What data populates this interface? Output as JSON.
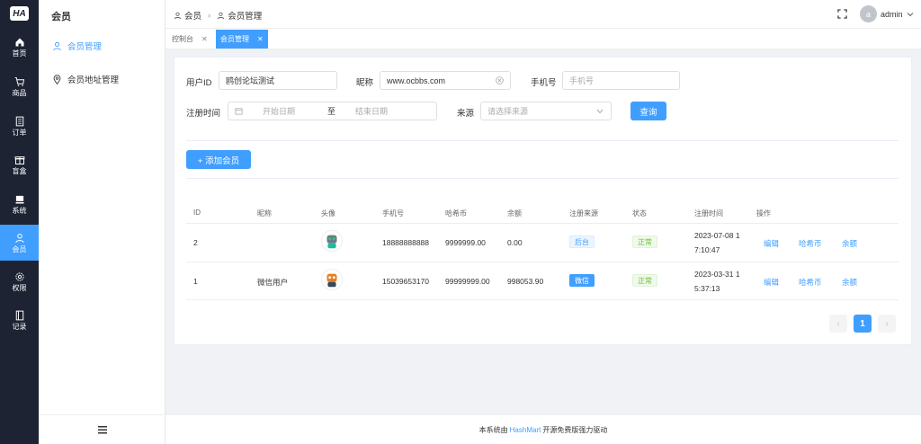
{
  "rail": {
    "logo": "HA",
    "items": [
      {
        "label": "首页"
      },
      {
        "label": "商品"
      },
      {
        "label": "订单"
      },
      {
        "label": "盲盒"
      },
      {
        "label": "系统"
      },
      {
        "label": "会员"
      },
      {
        "label": "权限"
      },
      {
        "label": "记录"
      }
    ]
  },
  "submenu": {
    "title": "会员",
    "items": [
      {
        "label": "会员管理"
      },
      {
        "label": "会员地址管理"
      }
    ]
  },
  "header": {
    "breadcrumb": [
      "会员",
      "会员管理"
    ],
    "avatar_letter": "a",
    "username": "admin"
  },
  "tabs": [
    {
      "label": "控制台"
    },
    {
      "label": "会员管理"
    }
  ],
  "filters": {
    "user_id_label": "用户ID",
    "user_id_value": "鸥创论坛测试",
    "nickname_label": "昵称",
    "nickname_value": "www.ocbbs.com",
    "phone_label": "手机号",
    "phone_placeholder": "手机号",
    "reg_time_label": "注册时间",
    "start_placeholder": "开始日期",
    "range_sep": "至",
    "end_placeholder": "结束日期",
    "source_label": "来源",
    "source_placeholder": "请选择来源",
    "query_button": "查询"
  },
  "add_button": "+ 添加会员",
  "table": {
    "headers": [
      "ID",
      "昵称",
      "头像",
      "手机号",
      "哈希币",
      "余额",
      "注册来源",
      "状态",
      "注册时间",
      "操作"
    ],
    "rows": [
      {
        "id": "2",
        "nickname": "",
        "phone": "18888888888",
        "hash": "9999999.00",
        "balance": "0.00",
        "source": "后台",
        "status": "正常",
        "time1": "2023-07-08 1",
        "time2": "7:10:47",
        "a1": "编辑",
        "a2": "哈希币",
        "a3": "余额"
      },
      {
        "id": "1",
        "nickname": "微信用户",
        "phone": "15039653170",
        "hash": "99999999.00",
        "balance": "998053.90",
        "source": "微信",
        "status": "正常",
        "time1": "2023-03-31 1",
        "time2": "5:37:13",
        "a1": "编辑",
        "a2": "哈希币",
        "a3": "余额"
      }
    ]
  },
  "pagination": {
    "prev": "‹",
    "current": "1",
    "next": "›"
  },
  "footer": {
    "prefix": "本系统由",
    "brand": "HashMart",
    "suffix": "开源免费版强力驱动"
  },
  "colors": {
    "primary": "#409eff",
    "rail_bg": "#1d2333",
    "success": "#67c23a"
  }
}
